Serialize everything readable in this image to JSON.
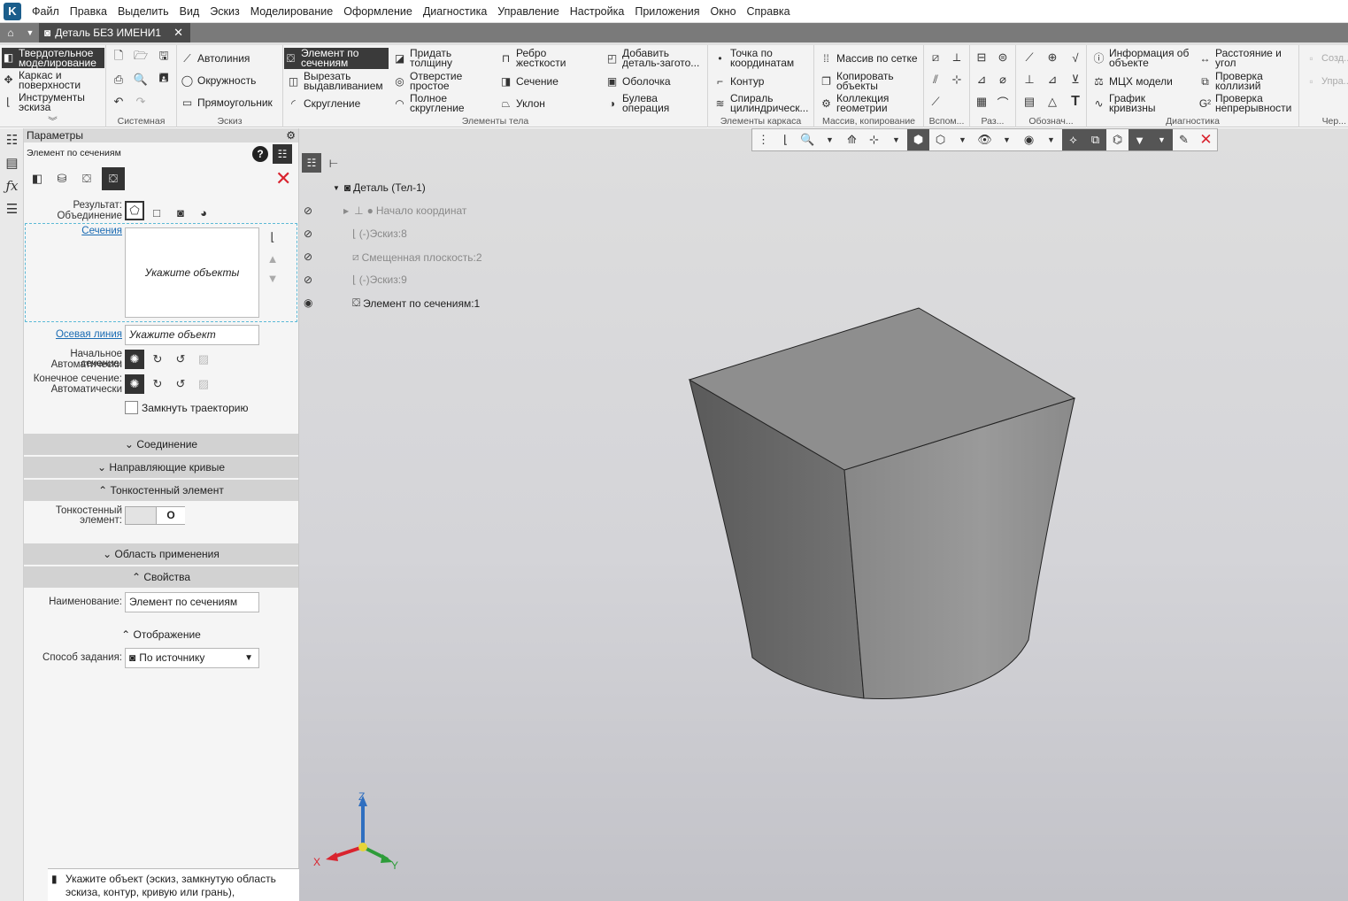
{
  "menu": [
    "Файл",
    "Правка",
    "Выделить",
    "Вид",
    "Эскиз",
    "Моделирование",
    "Оформление",
    "Диагностика",
    "Управление",
    "Настройка",
    "Приложения",
    "Окно",
    "Справка"
  ],
  "doc_tab": {
    "title": "Деталь БЕЗ ИМЕНИ1",
    "close": "✕"
  },
  "ribbon": {
    "modes": [
      "Твердотельное моделирование",
      "Каркас и поверхности",
      "Инструменты эскиза"
    ],
    "system_label": "Системная",
    "sketch": {
      "items": [
        "Автолиния",
        "Окружность",
        "Прямоугольник"
      ],
      "label": "Эскиз"
    },
    "body": {
      "items": [
        "Элемент по сечениям",
        "Вырезать выдавливанием",
        "Скругление",
        "Придать толщину",
        "Отверстие простое",
        "Полное скругление",
        "Ребро жесткости",
        "Сечение",
        "Уклон",
        "Добавить деталь-загото...",
        "Оболочка",
        "Булева операция"
      ],
      "label": "Элементы тела"
    },
    "frame": {
      "items": [
        "Точка по координатам",
        "Контур",
        "Спираль цилиндрическ..."
      ],
      "label": "Элементы каркаса"
    },
    "array": {
      "items": [
        "Массив по сетке",
        "Копировать объекты",
        "Коллекция геометрии"
      ],
      "label": "Массив, копирование"
    },
    "aux_label": "Вспом...",
    "sizes_label": "Раз...",
    "marks_label": "Обознач...",
    "diag": {
      "items": [
        "Информация об объекте",
        "МЦХ модели",
        "График кривизны",
        "Расстояние и угол",
        "Проверка коллизий",
        "Проверка непрерывности"
      ],
      "label": "Диагностика"
    },
    "extra": {
      "items": [
        "Созд... по св...",
        "Упра... связ..."
      ],
      "label": "Чер..."
    }
  },
  "panel": {
    "title": "Параметры",
    "subtitle": "Элемент по сечениям",
    "result_label": "Результат:",
    "result_value": "Объединение",
    "sections_link": "Сечения",
    "sections_placeholder": "Укажите объекты",
    "axis_link": "Осевая линия",
    "axis_placeholder": "Укажите объект",
    "start_label": "Начальное сечение:",
    "start_value": "Автоматически",
    "end_label": "Конечное сечение:",
    "end_value": "Автоматически",
    "close_traj": "Замкнуть траекторию",
    "sec_connection": "Соединение",
    "sec_guides": "Направляющие кривые",
    "sec_thin": "Тонкостенный элемент",
    "thin_label": "Тонкостенный элемент:",
    "sec_area": "Область применения",
    "sec_props": "Свойства",
    "name_label": "Наименование:",
    "name_value": "Элемент по сечениям",
    "sec_display": "Отображение",
    "mode_label": "Способ задания:",
    "mode_value": "По источнику",
    "status": "Укажите объект (эскиз, замкнутую область эскиза, контур, кривую или грань),"
  },
  "tree": [
    {
      "label": "Деталь (Тел-1)",
      "dim": false
    },
    {
      "label": "Начало координат",
      "dim": true
    },
    {
      "label": "(-)Эскиз:8",
      "dim": true
    },
    {
      "label": "Смещенная плоскость:2",
      "dim": true
    },
    {
      "label": "(-)Эскиз:9",
      "dim": true
    },
    {
      "label": "Элемент по сечениям:1",
      "dim": false
    }
  ],
  "axes": {
    "x": "X",
    "y": "Y",
    "z": "Z"
  },
  "colors": {
    "accent": "#3a3a3a",
    "close_red": "#d9232e",
    "axis_x": "#d9232e",
    "axis_y": "#2e9c3a",
    "axis_z": "#2f6fc0"
  }
}
